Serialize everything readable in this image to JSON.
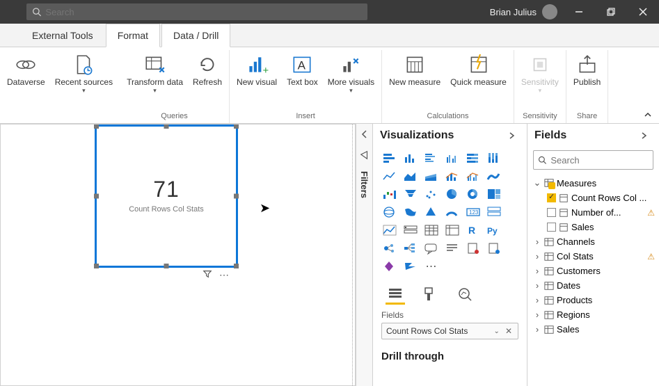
{
  "titlebar": {
    "search_placeholder": "Search",
    "user_name": "Brian Julius"
  },
  "tabs": {
    "external_tools": "External Tools",
    "format": "Format",
    "data_drill": "Data / Drill"
  },
  "ribbon": {
    "dataverse": "Dataverse",
    "recent_sources": "Recent sources",
    "transform_data": "Transform data",
    "refresh": "Refresh",
    "new_visual": "New visual",
    "text_box": "Text box",
    "more_visuals": "More visuals",
    "new_measure": "New measure",
    "quick_measure": "Quick measure",
    "sensitivity": "Sensitivity",
    "publish": "Publish",
    "group_queries": "Queries",
    "group_insert": "Insert",
    "group_calculations": "Calculations",
    "group_sensitivity": "Sensitivity",
    "group_share": "Share"
  },
  "visual": {
    "value": "71",
    "label": "Count Rows Col Stats"
  },
  "panes": {
    "filters_label": "Filters",
    "visualizations_title": "Visualizations",
    "fields_title": "Fields",
    "fields_label": "Fields",
    "well_value": "Count Rows Col Stats",
    "drill_title": "Drill through",
    "field_search_placeholder": "Search"
  },
  "fields_tree": {
    "measures": "Measures",
    "count_rows": "Count Rows Col ...",
    "number_of": "Number of...",
    "sales_measure": "Sales",
    "channels": "Channels",
    "col_stats": "Col Stats",
    "customers": "Customers",
    "dates": "Dates",
    "products": "Products",
    "regions": "Regions",
    "sales": "Sales"
  }
}
